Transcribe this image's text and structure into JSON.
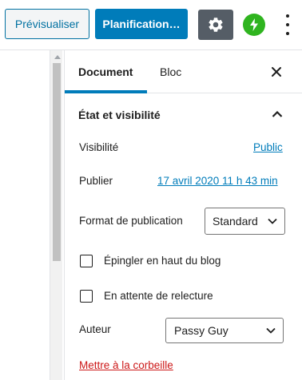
{
  "toolbar": {
    "preview_label": "Prévisualiser",
    "schedule_label": "Planification…",
    "settings_icon": "gear-icon",
    "jetpack_icon": "jetpack-icon",
    "more_icon": "more-vertical-icon",
    "accent_color": "#007cba",
    "jetpack_color": "#2fb41f"
  },
  "sidebar": {
    "tabs": [
      {
        "label": "Document",
        "active": true
      },
      {
        "label": "Bloc",
        "active": false
      }
    ],
    "close_icon": "close-icon",
    "panel": {
      "title": "État et visibilité",
      "expanded": true,
      "visibility_label": "Visibilité",
      "visibility_value": "Public",
      "publish_label": "Publier",
      "publish_value": "17 avril 2020 11 h 43 min",
      "format_label": "Format de publication",
      "format_value": "Standard",
      "sticky_label": "Épingler en haut du blog",
      "sticky_checked": false,
      "pending_label": "En attente de relecture",
      "pending_checked": false,
      "author_label": "Auteur",
      "author_value": "Passy Guy",
      "trash_label": "Mettre à la corbeille",
      "trash_color": "#cc1818"
    }
  }
}
